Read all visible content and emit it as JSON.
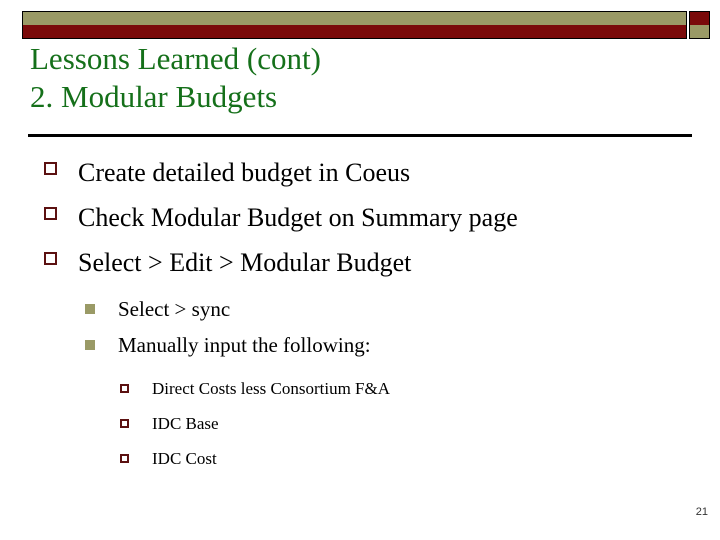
{
  "slide": {
    "title_lines": [
      "Lessons Learned (cont)",
      "2. Modular Budgets"
    ],
    "page_number": "21",
    "colors": {
      "title_green": "#15701a",
      "banner_tan": "#9a9a66",
      "banner_maroon": "#7a0a0a",
      "bullet_maroon": "#5c1111",
      "bullet_tan": "#9a9a66",
      "rule_black": "#000000",
      "body_text": "#000000"
    },
    "bullets": {
      "level1": [
        {
          "text": "Create detailed budget in Coeus",
          "marker": "hollow-square-maroon"
        },
        {
          "text": "Check Modular Budget on Summary page",
          "marker": "hollow-square-maroon"
        },
        {
          "text": "Select > Edit > Modular Budget",
          "marker": "hollow-square-maroon"
        }
      ],
      "level2": [
        {
          "text": "Select > sync",
          "marker": "filled-square-tan"
        },
        {
          "text": "Manually input the following:",
          "marker": "filled-square-tan"
        }
      ],
      "level3": [
        {
          "text": "Direct Costs less Consortium F&A",
          "marker": "hollow-square-maroon-small"
        },
        {
          "text": "IDC Base",
          "marker": "hollow-square-maroon-small"
        },
        {
          "text": "IDC Cost",
          "marker": "hollow-square-maroon-small"
        }
      ]
    }
  }
}
